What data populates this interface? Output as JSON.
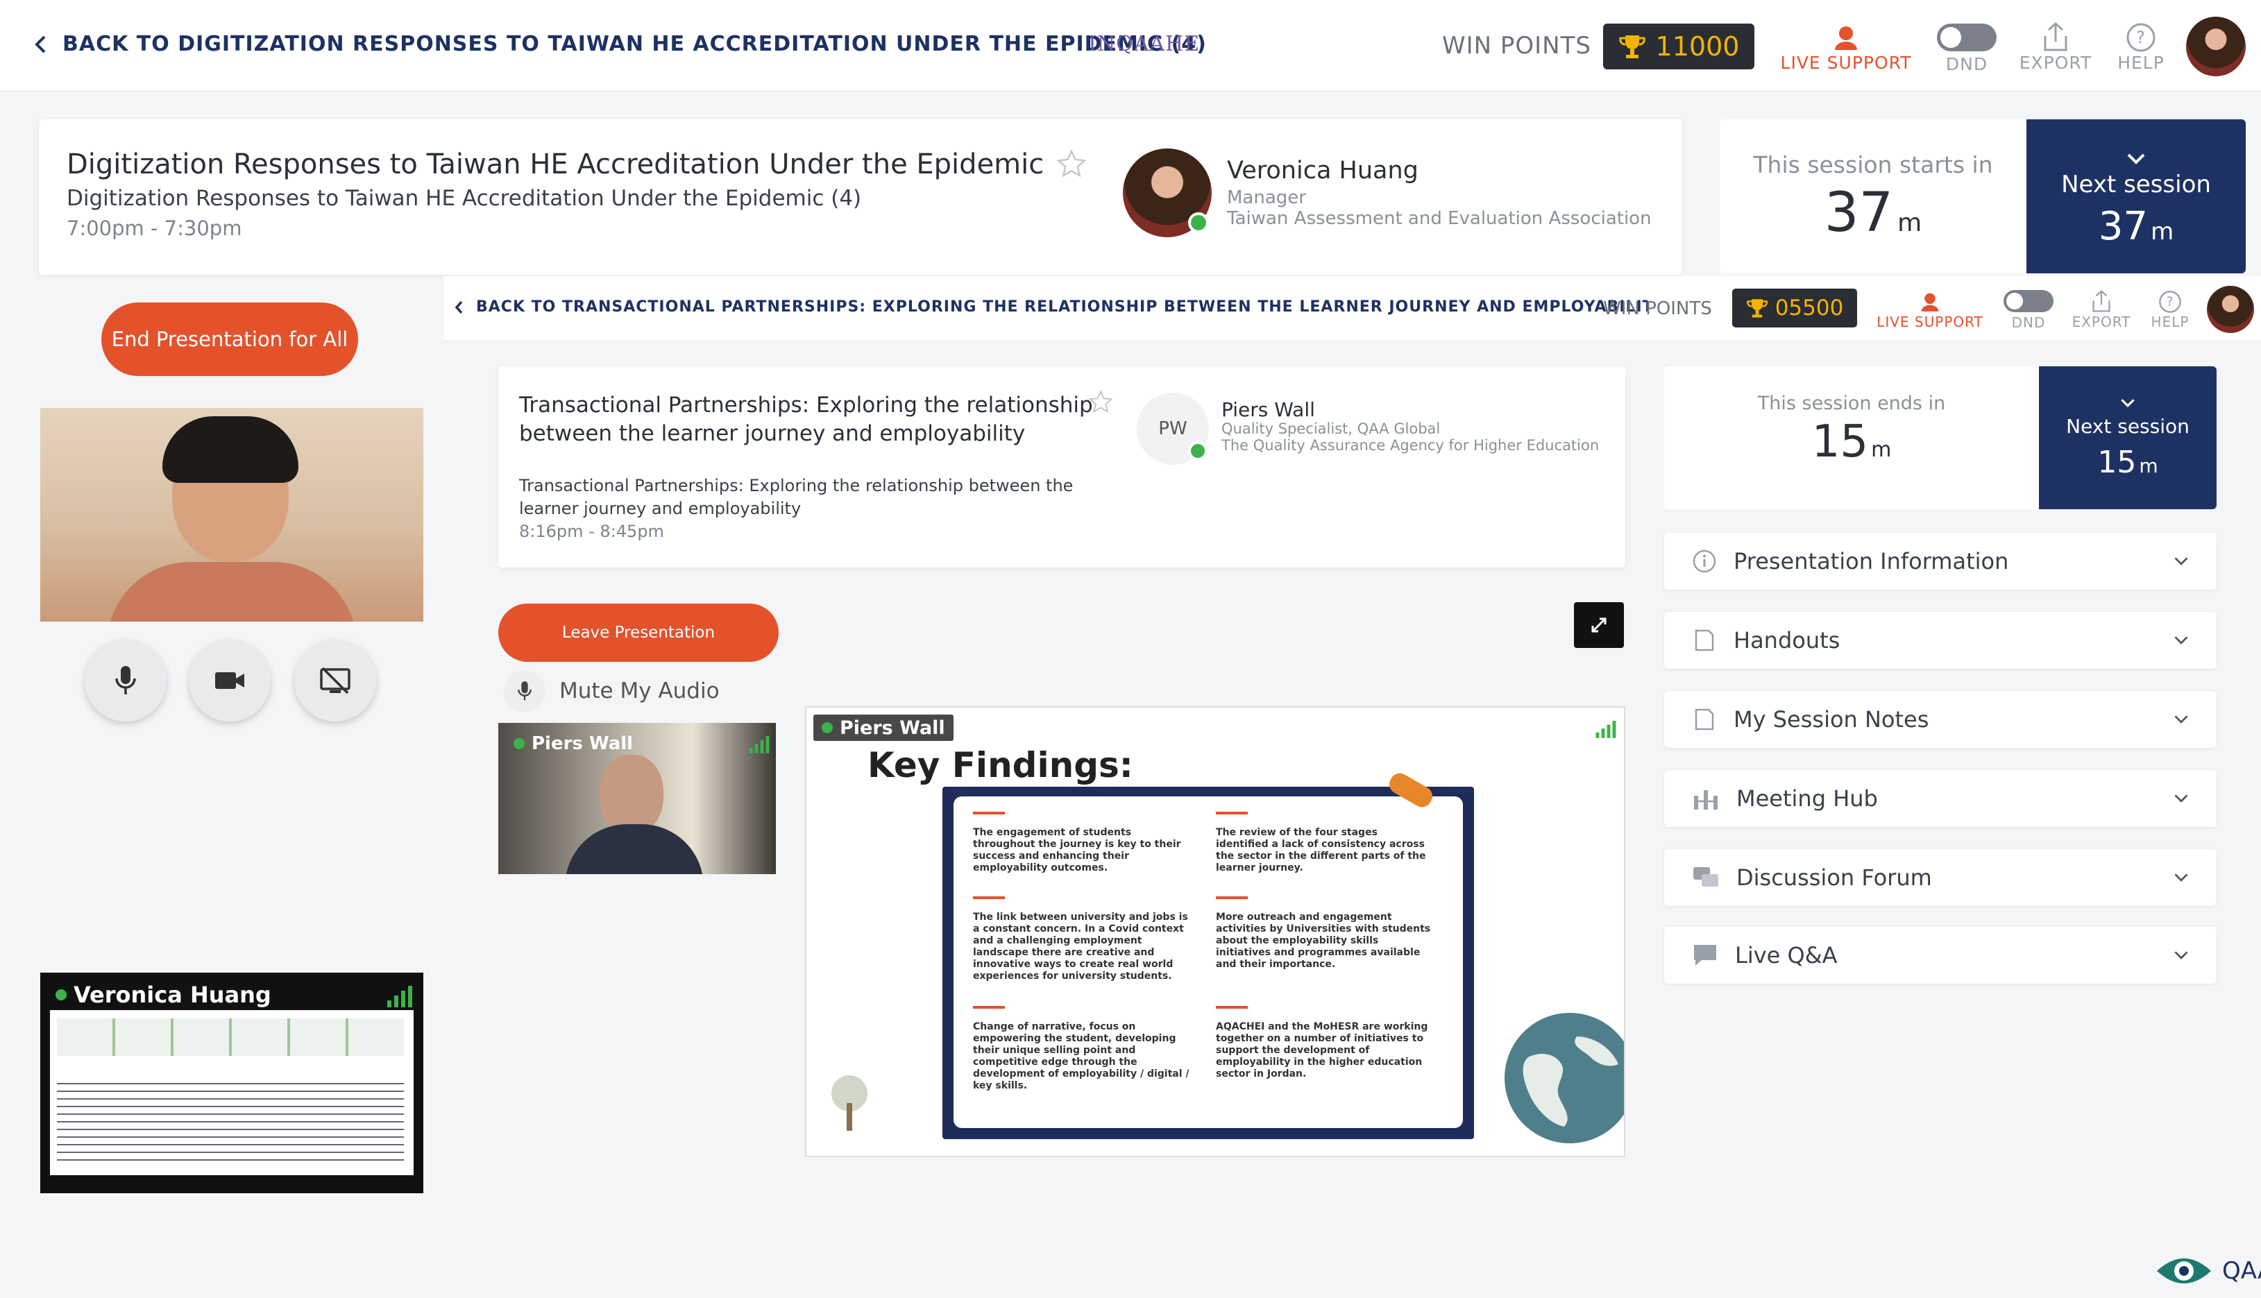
{
  "topbar": {
    "back_text": "BACK TO DIGITIZATION RESPONSES TO TAIWAN HE ACCREDITATION UNDER THE EPIDEMIC (4)",
    "logo_text": "INQAAHE",
    "win_points_label": "WIN POINTS",
    "points": "11000",
    "live_support": "LIVE SUPPORT",
    "dnd": "DND",
    "export": "EXPORT",
    "help": "HELP"
  },
  "session": {
    "title": "Digitization Responses to Taiwan HE Accreditation Under the Epidemic",
    "subtitle": "Digitization Responses to Taiwan HE Accreditation Under the Epidemic (4)",
    "time": "7:00pm - 7:30pm",
    "speaker_name": "Veronica Huang",
    "speaker_role": "Manager",
    "speaker_org": "Taiwan Assessment and Evaluation Association",
    "starts_label": "This session starts in",
    "starts_value": "37",
    "unit": "m",
    "next_label": "Next session",
    "next_value": "37"
  },
  "left": {
    "end_button": "End Presentation for All",
    "thumb_name": "Veronica Huang"
  },
  "inner": {
    "back_text": "BACK TO TRANSACTIONAL PARTNERSHIPS: EXPLORING THE RELATIONSHIP BETWEEN THE LEARNER JOURNEY AND EMPLOYABILITY",
    "win_points_label": "WIN POINTS",
    "points": "05500",
    "live_support": "LIVE SUPPORT",
    "dnd": "DND",
    "export": "EXPORT",
    "help": "HELP",
    "title": "Transactional Partnerships: Exploring the relationship between the learner journey and employability",
    "subtitle": "Transactional Partnerships: Exploring the relationship between the learner journey and employability",
    "time": "8:16pm - 8:45pm",
    "speaker_initials": "PW",
    "speaker_name": "Piers Wall",
    "speaker_role": "Quality Specialist, QAA Global",
    "speaker_org": "The Quality Assurance Agency for Higher Education",
    "ends_label": "This session ends in",
    "ends_value": "15",
    "unit": "m",
    "next_label": "Next session",
    "next_value": "15",
    "leave_button": "Leave Presentation",
    "mute_label": "Mute My Audio",
    "video_name": "Piers Wall",
    "screen_name": "Piers Wall",
    "slide_title": "Key Findings:",
    "slide_points": [
      "The engagement of students throughout the journey is key to their success and enhancing their employability outcomes.",
      "The review of the four stages identified a lack of consistency across the sector in the different parts of the learner journey.",
      "The link between university and jobs is a constant concern. In a Covid context and a challenging employment landscape there are creative and innovative ways to create real world experiences for university students.",
      "More outreach and engagement activities by Universities with students about the employability skills initiatives and programmes available and their importance.",
      "Change of narrative, focus on empowering the student, developing their unique selling point and competitive edge through the development of employability / digital / key skills.",
      "AQACHEI and the MoHESR are working together on a number of initiatives to support the development of employability in the higher education sector in Jordan."
    ],
    "accordion": [
      "Presentation Information",
      "Handouts",
      "My Session Notes",
      "Meeting Hub",
      "Discussion Forum",
      "Live Q&A"
    ]
  },
  "footer": {
    "logo_text": "QAA"
  },
  "colors": {
    "navy": "#1e3163",
    "orange": "#e4522c",
    "gold": "#f3b400",
    "green": "#3bb34a"
  }
}
